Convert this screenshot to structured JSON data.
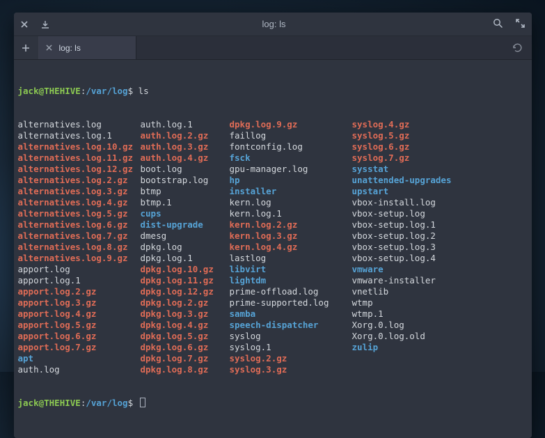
{
  "window": {
    "title": "log: ls"
  },
  "tab": {
    "label": "log: ls"
  },
  "prompt": {
    "user": "jack@THEHIVE",
    "colon": ":",
    "path": "/var/log",
    "dollar": "$",
    "command": "ls"
  },
  "listing": [
    [
      {
        "t": "alternatives.log",
        "c": "white"
      },
      {
        "t": "auth.log.1",
        "c": "white"
      },
      {
        "t": "dpkg.log.9.gz",
        "c": "red"
      },
      {
        "t": "syslog.4.gz",
        "c": "red"
      }
    ],
    [
      {
        "t": "alternatives.log.1",
        "c": "white"
      },
      {
        "t": "auth.log.2.gz",
        "c": "red"
      },
      {
        "t": "faillog",
        "c": "white"
      },
      {
        "t": "syslog.5.gz",
        "c": "red"
      }
    ],
    [
      {
        "t": "alternatives.log.10.gz",
        "c": "red"
      },
      {
        "t": "auth.log.3.gz",
        "c": "red"
      },
      {
        "t": "fontconfig.log",
        "c": "white"
      },
      {
        "t": "syslog.6.gz",
        "c": "red"
      }
    ],
    [
      {
        "t": "alternatives.log.11.gz",
        "c": "red"
      },
      {
        "t": "auth.log.4.gz",
        "c": "red"
      },
      {
        "t": "fsck",
        "c": "blue"
      },
      {
        "t": "syslog.7.gz",
        "c": "red"
      }
    ],
    [
      {
        "t": "alternatives.log.12.gz",
        "c": "red"
      },
      {
        "t": "boot.log",
        "c": "white"
      },
      {
        "t": "gpu-manager.log",
        "c": "white"
      },
      {
        "t": "sysstat",
        "c": "blue"
      }
    ],
    [
      {
        "t": "alternatives.log.2.gz",
        "c": "red"
      },
      {
        "t": "bootstrap.log",
        "c": "white"
      },
      {
        "t": "hp",
        "c": "blue"
      },
      {
        "t": "unattended-upgrades",
        "c": "blue"
      }
    ],
    [
      {
        "t": "alternatives.log.3.gz",
        "c": "red"
      },
      {
        "t": "btmp",
        "c": "white"
      },
      {
        "t": "installer",
        "c": "blue"
      },
      {
        "t": "upstart",
        "c": "blue"
      }
    ],
    [
      {
        "t": "alternatives.log.4.gz",
        "c": "red"
      },
      {
        "t": "btmp.1",
        "c": "white"
      },
      {
        "t": "kern.log",
        "c": "white"
      },
      {
        "t": "vbox-install.log",
        "c": "white"
      }
    ],
    [
      {
        "t": "alternatives.log.5.gz",
        "c": "red"
      },
      {
        "t": "cups",
        "c": "blue"
      },
      {
        "t": "kern.log.1",
        "c": "white"
      },
      {
        "t": "vbox-setup.log",
        "c": "white"
      }
    ],
    [
      {
        "t": "alternatives.log.6.gz",
        "c": "red"
      },
      {
        "t": "dist-upgrade",
        "c": "blue"
      },
      {
        "t": "kern.log.2.gz",
        "c": "red"
      },
      {
        "t": "vbox-setup.log.1",
        "c": "white"
      }
    ],
    [
      {
        "t": "alternatives.log.7.gz",
        "c": "red"
      },
      {
        "t": "dmesg",
        "c": "white"
      },
      {
        "t": "kern.log.3.gz",
        "c": "red"
      },
      {
        "t": "vbox-setup.log.2",
        "c": "white"
      }
    ],
    [
      {
        "t": "alternatives.log.8.gz",
        "c": "red"
      },
      {
        "t": "dpkg.log",
        "c": "white"
      },
      {
        "t": "kern.log.4.gz",
        "c": "red"
      },
      {
        "t": "vbox-setup.log.3",
        "c": "white"
      }
    ],
    [
      {
        "t": "alternatives.log.9.gz",
        "c": "red"
      },
      {
        "t": "dpkg.log.1",
        "c": "white"
      },
      {
        "t": "lastlog",
        "c": "white"
      },
      {
        "t": "vbox-setup.log.4",
        "c": "white"
      }
    ],
    [
      {
        "t": "apport.log",
        "c": "white"
      },
      {
        "t": "dpkg.log.10.gz",
        "c": "red"
      },
      {
        "t": "libvirt",
        "c": "blue"
      },
      {
        "t": "vmware",
        "c": "blue"
      }
    ],
    [
      {
        "t": "apport.log.1",
        "c": "white"
      },
      {
        "t": "dpkg.log.11.gz",
        "c": "red"
      },
      {
        "t": "lightdm",
        "c": "blue"
      },
      {
        "t": "vmware-installer",
        "c": "white"
      }
    ],
    [
      {
        "t": "apport.log.2.gz",
        "c": "red"
      },
      {
        "t": "dpkg.log.12.gz",
        "c": "red"
      },
      {
        "t": "prime-offload.log",
        "c": "white"
      },
      {
        "t": "vnetlib",
        "c": "white"
      }
    ],
    [
      {
        "t": "apport.log.3.gz",
        "c": "red"
      },
      {
        "t": "dpkg.log.2.gz",
        "c": "red"
      },
      {
        "t": "prime-supported.log",
        "c": "white"
      },
      {
        "t": "wtmp",
        "c": "white"
      }
    ],
    [
      {
        "t": "apport.log.4.gz",
        "c": "red"
      },
      {
        "t": "dpkg.log.3.gz",
        "c": "red"
      },
      {
        "t": "samba",
        "c": "blue"
      },
      {
        "t": "wtmp.1",
        "c": "white"
      }
    ],
    [
      {
        "t": "apport.log.5.gz",
        "c": "red"
      },
      {
        "t": "dpkg.log.4.gz",
        "c": "red"
      },
      {
        "t": "speech-dispatcher",
        "c": "blue"
      },
      {
        "t": "Xorg.0.log",
        "c": "white"
      }
    ],
    [
      {
        "t": "apport.log.6.gz",
        "c": "red"
      },
      {
        "t": "dpkg.log.5.gz",
        "c": "red"
      },
      {
        "t": "syslog",
        "c": "white"
      },
      {
        "t": "Xorg.0.log.old",
        "c": "white"
      }
    ],
    [
      {
        "t": "apport.log.7.gz",
        "c": "red"
      },
      {
        "t": "dpkg.log.6.gz",
        "c": "red"
      },
      {
        "t": "syslog.1",
        "c": "white"
      },
      {
        "t": "zulip",
        "c": "blue"
      }
    ],
    [
      {
        "t": "apt",
        "c": "blue"
      },
      {
        "t": "dpkg.log.7.gz",
        "c": "red"
      },
      {
        "t": "syslog.2.gz",
        "c": "red"
      },
      {
        "t": "",
        "c": "white"
      }
    ],
    [
      {
        "t": "auth.log",
        "c": "white"
      },
      {
        "t": "dpkg.log.8.gz",
        "c": "red"
      },
      {
        "t": "syslog.3.gz",
        "c": "red"
      },
      {
        "t": "",
        "c": "white"
      }
    ]
  ]
}
